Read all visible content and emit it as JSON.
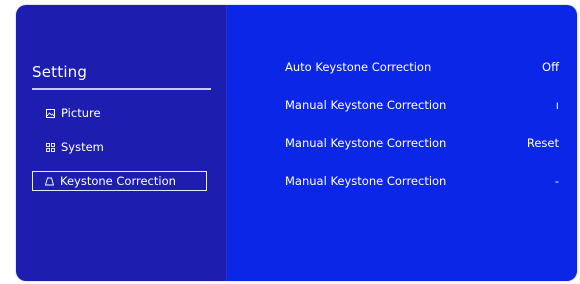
{
  "sidebar": {
    "title": "Setting",
    "items": [
      {
        "label": "Picture",
        "icon": "picture-icon",
        "selected": false
      },
      {
        "label": "System",
        "icon": "system-icon",
        "selected": false
      },
      {
        "label": "Keystone Correction",
        "icon": "keystone-icon",
        "selected": true
      }
    ]
  },
  "main": {
    "rows": [
      {
        "label": "Auto Keystone Correction",
        "value": "Off"
      },
      {
        "label": "Manual Keystone Correction",
        "value": "ı"
      },
      {
        "label": "Manual Keystone Correction",
        "value": "Reset"
      },
      {
        "label": "Manual Keystone Correction",
        "value": "-"
      }
    ]
  },
  "colors": {
    "sidebar_bg": "#1d1daf",
    "main_bg": "#0c26e8",
    "text": "#ffffff"
  }
}
